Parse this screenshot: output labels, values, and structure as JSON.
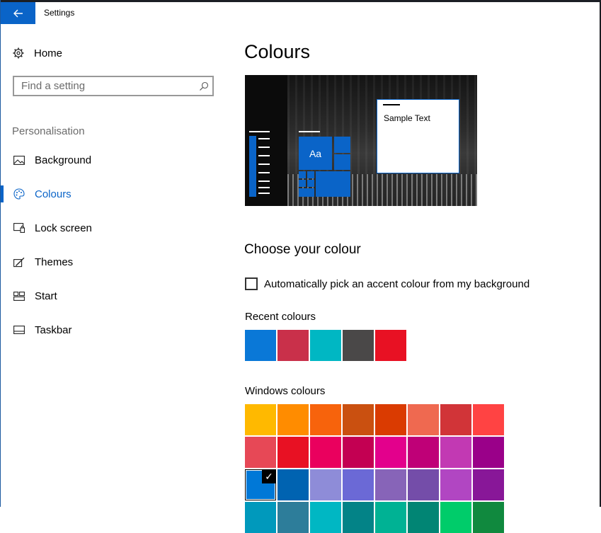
{
  "window": {
    "title": "Settings"
  },
  "sidebar": {
    "home_label": "Home",
    "search_placeholder": "Find a setting",
    "section_label": "Personalisation",
    "items": [
      {
        "label": "Background",
        "icon": "picture-icon",
        "active": false
      },
      {
        "label": "Colours",
        "icon": "palette-icon",
        "active": true
      },
      {
        "label": "Lock screen",
        "icon": "lock-screen-icon",
        "active": false
      },
      {
        "label": "Themes",
        "icon": "themes-icon",
        "active": false
      },
      {
        "label": "Start",
        "icon": "start-icon",
        "active": false
      },
      {
        "label": "Taskbar",
        "icon": "taskbar-icon",
        "active": false
      }
    ]
  },
  "main": {
    "title": "Colours",
    "preview": {
      "tile_text": "Aa",
      "sample_text": "Sample Text"
    },
    "choose_heading": "Choose your colour",
    "auto_pick_label": "Automatically pick an accent colour from my background",
    "auto_pick_checked": false,
    "recent_label": "Recent colours",
    "recent_colours": [
      "#0a78d7",
      "#c9304a",
      "#00b7c3",
      "#4a4848",
      "#e81123"
    ],
    "windows_label": "Windows colours",
    "windows_colours": [
      [
        "#ffb900",
        "#ff8c00",
        "#f7630c",
        "#ca5010",
        "#da3b01",
        "#ef6950",
        "#d13438",
        "#ff4343"
      ],
      [
        "#e74856",
        "#e81123",
        "#ea005e",
        "#c30052",
        "#e3008c",
        "#bf0077",
        "#c239b3",
        "#9a0089"
      ],
      [
        "#0078d7",
        "#0063b1",
        "#8e8cd8",
        "#6b69d6",
        "#8764b8",
        "#744da9",
        "#b146c2",
        "#881798"
      ],
      [
        "#0099bc",
        "#2d7d9a",
        "#00b7c3",
        "#038387",
        "#00b294",
        "#018574",
        "#00cc6a",
        "#10893e"
      ]
    ],
    "selected_colour": "#0078d7",
    "accent": "#0a64c8"
  }
}
